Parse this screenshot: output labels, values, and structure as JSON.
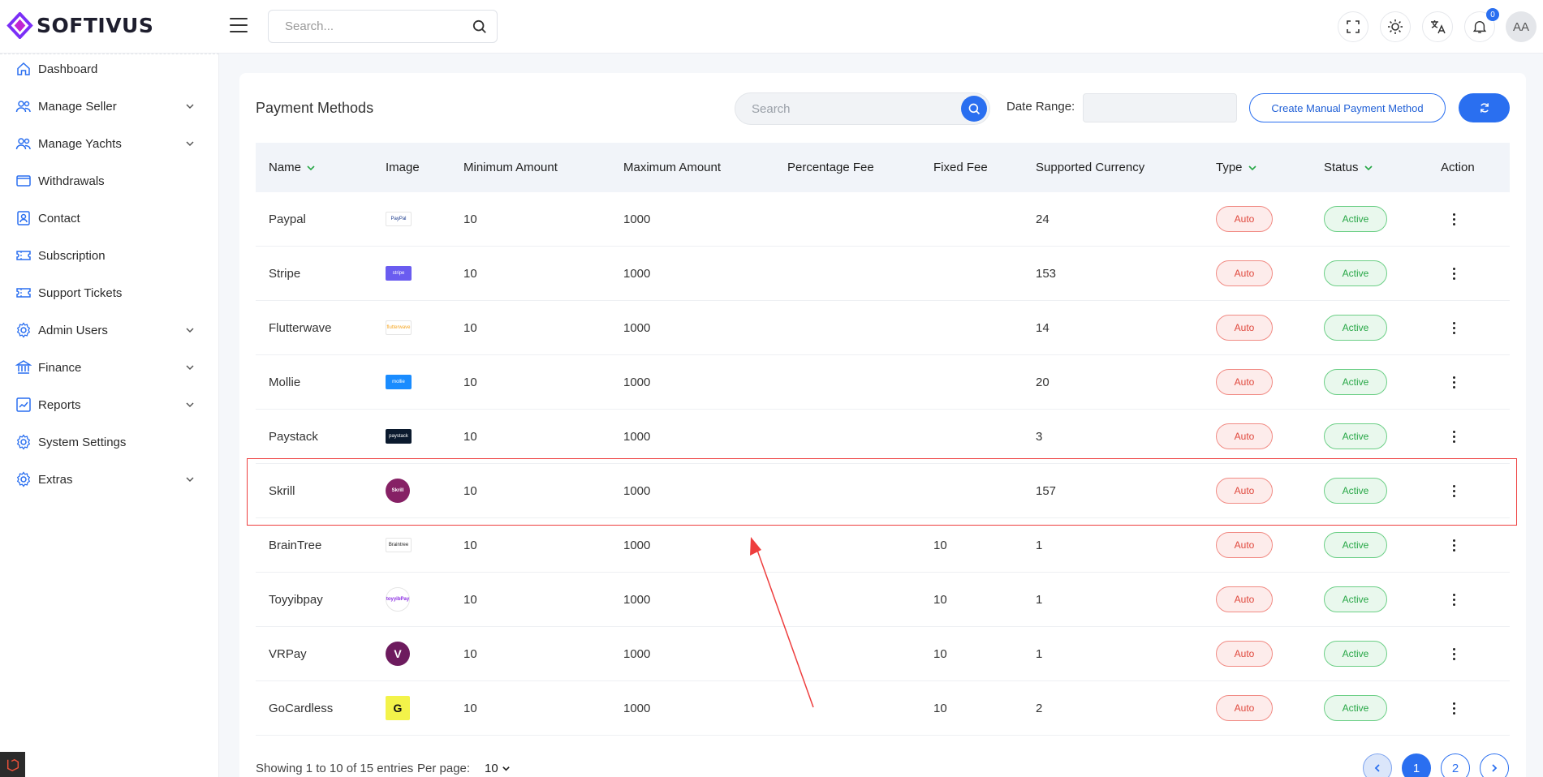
{
  "brand": {
    "name": "SOFTIVUS"
  },
  "header": {
    "search_placeholder": "Search...",
    "notification_count": "0",
    "avatar_initials": "AA"
  },
  "sidebar": {
    "items": [
      {
        "label": "Dashboard",
        "icon": "home-icon",
        "has_children": false
      },
      {
        "label": "Manage Seller",
        "icon": "users-icon",
        "has_children": true
      },
      {
        "label": "Manage Yachts",
        "icon": "users-icon",
        "has_children": true
      },
      {
        "label": "Withdrawals",
        "icon": "wallet-icon",
        "has_children": false
      },
      {
        "label": "Contact",
        "icon": "contact-icon",
        "has_children": false
      },
      {
        "label": "Subscription",
        "icon": "ticket-icon",
        "has_children": false
      },
      {
        "label": "Support Tickets",
        "icon": "ticket-icon",
        "has_children": false
      },
      {
        "label": "Admin Users",
        "icon": "gear-icon",
        "has_children": true
      },
      {
        "label": "Finance",
        "icon": "bank-icon",
        "has_children": true
      },
      {
        "label": "Reports",
        "icon": "report-icon",
        "has_children": true
      },
      {
        "label": "System Settings",
        "icon": "gear-icon",
        "has_children": false
      },
      {
        "label": "Extras",
        "icon": "gear-icon",
        "has_children": true
      }
    ]
  },
  "page": {
    "title": "Payment Methods",
    "search_placeholder": "Search",
    "date_range_label": "Date Range:",
    "create_button": "Create Manual Payment Method"
  },
  "table": {
    "headers": [
      "Name",
      "Image",
      "Minimum Amount",
      "Maximum Amount",
      "Percentage Fee",
      "Fixed Fee",
      "Supported Currency",
      "Type",
      "Status",
      "Action"
    ],
    "rows": [
      {
        "name": "Paypal",
        "img_text": "PayPal",
        "img_bg": "#ffffff",
        "img_fg": "#1b3a8c",
        "min": "10",
        "max": "1000",
        "pct": "",
        "fixed": "",
        "currency": "24",
        "type": "Auto",
        "status": "Active"
      },
      {
        "name": "Stripe",
        "img_text": "stripe",
        "img_bg": "#6a5cf0",
        "img_fg": "#ffffff",
        "min": "10",
        "max": "1000",
        "pct": "",
        "fixed": "",
        "currency": "153",
        "type": "Auto",
        "status": "Active"
      },
      {
        "name": "Flutterwave",
        "img_text": "flutterwave",
        "img_bg": "#ffffff",
        "img_fg": "#f5a623",
        "min": "10",
        "max": "1000",
        "pct": "",
        "fixed": "",
        "currency": "14",
        "type": "Auto",
        "status": "Active"
      },
      {
        "name": "Mollie",
        "img_text": "mollie",
        "img_bg": "#1a8cff",
        "img_fg": "#ffffff",
        "min": "10",
        "max": "1000",
        "pct": "",
        "fixed": "",
        "currency": "20",
        "type": "Auto",
        "status": "Active"
      },
      {
        "name": "Paystack",
        "img_text": "paystack",
        "img_bg": "#0b1a2e",
        "img_fg": "#ffffff",
        "min": "10",
        "max": "1000",
        "pct": "",
        "fixed": "",
        "currency": "3",
        "type": "Auto",
        "status": "Active"
      },
      {
        "name": "Skrill",
        "img_text": "Skrill",
        "img_bg": "#862165",
        "img_fg": "#ffffff",
        "min": "10",
        "max": "1000",
        "pct": "",
        "fixed": "",
        "currency": "157",
        "type": "Auto",
        "status": "Active"
      },
      {
        "name": "BrainTree",
        "img_text": "Braintree",
        "img_bg": "#ffffff",
        "img_fg": "#222222",
        "min": "10",
        "max": "1000",
        "pct": "",
        "fixed": "10",
        "currency": "1",
        "type": "Auto",
        "status": "Active"
      },
      {
        "name": "Toyyibpay",
        "img_text": "toyyibPay",
        "img_bg": "#ffffff",
        "img_fg": "#8a2be2",
        "min": "10",
        "max": "1000",
        "pct": "",
        "fixed": "10",
        "currency": "1",
        "type": "Auto",
        "status": "Active"
      },
      {
        "name": "VRPay",
        "img_text": "V",
        "img_bg": "#6d1b5e",
        "img_fg": "#ffffff",
        "min": "10",
        "max": "1000",
        "pct": "",
        "fixed": "10",
        "currency": "1",
        "type": "Auto",
        "status": "Active"
      },
      {
        "name": "GoCardless",
        "img_text": "G",
        "img_bg": "#f3f34a",
        "img_fg": "#111111",
        "min": "10",
        "max": "1000",
        "pct": "",
        "fixed": "10",
        "currency": "2",
        "type": "Auto",
        "status": "Active"
      }
    ]
  },
  "footer": {
    "entries_text": "Showing 1 to 10 of 15 entries",
    "per_page_label": "Per page:",
    "per_page_value": "10",
    "pages": [
      "1",
      "2"
    ]
  },
  "colors": {
    "accent": "#2a6ff0",
    "auto_badge": "#e0483d",
    "active_badge": "#27a746",
    "annotation": "#ee3e3e"
  }
}
